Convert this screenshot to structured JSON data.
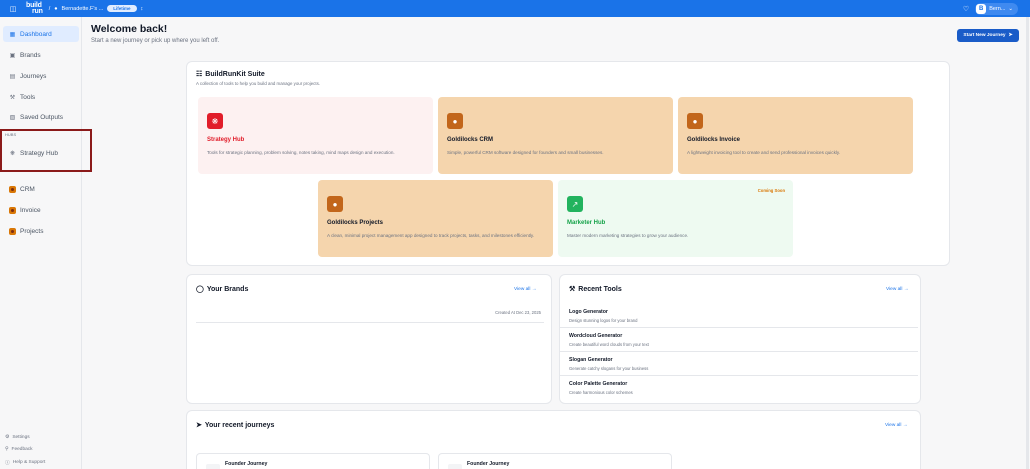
{
  "topbar": {
    "logo_line1": "build",
    "logo_line2": "run",
    "workspace": "Bernadette.F's ...",
    "plan_badge": "Lifetime",
    "user_initial": "B",
    "user_name": "Bern..."
  },
  "sidebar": {
    "items": [
      {
        "label": "Dashboard",
        "icon": "grid-icon"
      },
      {
        "label": "Brands",
        "icon": "box-icon"
      },
      {
        "label": "Journeys",
        "icon": "map-icon"
      },
      {
        "label": "Tools",
        "icon": "wrench-icon"
      },
      {
        "label": "Saved Outputs",
        "icon": "bookmark-icon"
      }
    ],
    "hubs_label": "HUBS",
    "hub_item": "Strategy Hub",
    "apps": [
      {
        "label": "CRM"
      },
      {
        "label": "Invoice"
      },
      {
        "label": "Projects"
      }
    ],
    "bottom": [
      {
        "label": "Settings"
      },
      {
        "label": "Feedback"
      },
      {
        "label": "Help & Support"
      }
    ]
  },
  "header": {
    "title": "Welcome back!",
    "subtitle": "Start a new journey or pick up where you left off.",
    "start_button": "Start New Journey"
  },
  "suite": {
    "title": "BuildRunKit Suite",
    "subtitle": "A collection of tools to help you build and manage your projects.",
    "cards": [
      {
        "title": "Strategy Hub",
        "desc": "Tools for strategic planning, problem solving, notes taking, mind maps design and execution.",
        "color": "#e11d2a"
      },
      {
        "title": "Goldilocks CRM",
        "desc": "Simple, powerful CRM software designed for founders and small businesses."
      },
      {
        "title": "Goldilocks Invoice",
        "desc": "A lightweight invoicing tool to create and send professional invoices quickly."
      },
      {
        "title": "Goldilocks Projects",
        "desc": "A clean, minimal project management app designed to track projects, tasks, and milestones efficiently."
      },
      {
        "title": "Marketer Hub",
        "desc": "Master modern marketing strategies to grow your audience.",
        "badge": "Coming Soon",
        "color": "#16a34a"
      }
    ]
  },
  "brands": {
    "title": "Your Brands",
    "view_all": "View all",
    "created": "Created At Dec 23, 2025"
  },
  "recent_tools": {
    "title": "Recent Tools",
    "view_all": "View all",
    "items": [
      {
        "title": "Logo Generator",
        "desc": "Design stunning logos for your brand"
      },
      {
        "title": "Wordcloud Generator",
        "desc": "Create beautiful word clouds from your text"
      },
      {
        "title": "Slogan Generator",
        "desc": "Generate catchy slogans for your business"
      },
      {
        "title": "Color Palette Generator",
        "desc": "Create harmonious color schemes"
      }
    ]
  },
  "journeys": {
    "title": "Your recent journeys",
    "view_all": "View all",
    "items": [
      {
        "title": "Founder Journey"
      },
      {
        "title": "Founder Journey"
      }
    ]
  }
}
